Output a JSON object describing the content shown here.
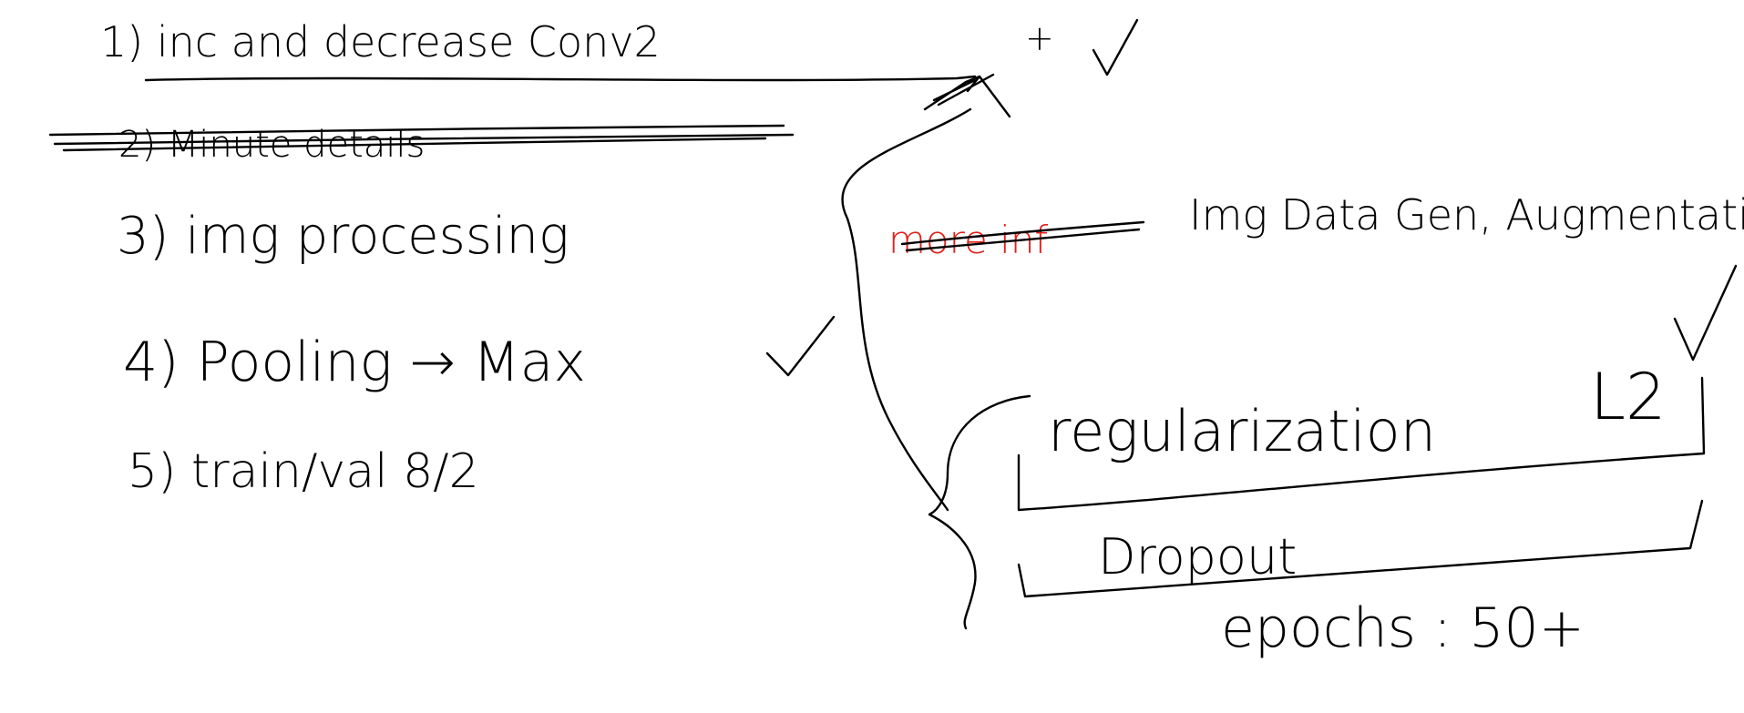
{
  "colors": {
    "ink": "#000000",
    "red_ink": "#e0201a",
    "background": "#ffffff"
  },
  "notes": {
    "item1": {
      "text": "1) inc and decrease Conv2",
      "plus": "+",
      "check": "✓"
    },
    "item2": {
      "text": "2) Minute details",
      "struck": true
    },
    "item3": {
      "text": "3) img processing"
    },
    "item4": {
      "text": "4) Pooling → Max",
      "check": "✓"
    },
    "item5": {
      "text": "5) train/val 8/2"
    },
    "side_note": {
      "struck_red_text": "more inf",
      "text": "Img Data Gen, Augmentation"
    },
    "bracket_group": {
      "regularization": "regularization",
      "regularization_marker": "L2",
      "dropout": "Dropout",
      "epochs": "epochs : 50+"
    },
    "extra_check": "✓"
  }
}
